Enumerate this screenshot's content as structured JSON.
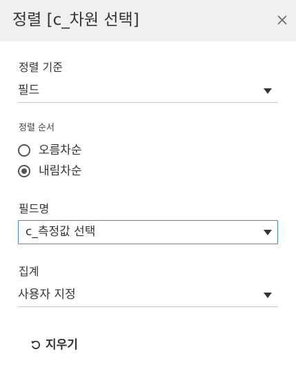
{
  "dialog": {
    "title": "정렬 [c_차원 선택]"
  },
  "sort_basis": {
    "label": "정렬 기준",
    "value": "필드"
  },
  "sort_order": {
    "label": "정렬 순서",
    "options": [
      {
        "label": "오름차순",
        "selected": false
      },
      {
        "label": "내림차순",
        "selected": true
      }
    ]
  },
  "field_name": {
    "label": "필드명",
    "value": "c_측정값 선택"
  },
  "aggregation": {
    "label": "집계",
    "value": "사용자 지정"
  },
  "clear": {
    "label": "지우기"
  },
  "icons": {
    "close": "close-icon",
    "dropdown": "chevron-down-icon",
    "clear": "refresh-icon"
  },
  "colors": {
    "header_bg": "#f0f0f0",
    "focus_border": "#3d8fd4"
  }
}
